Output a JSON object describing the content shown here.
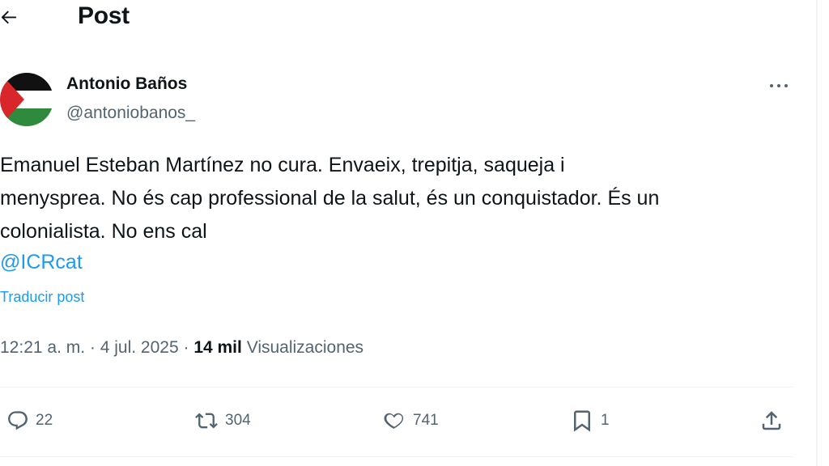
{
  "header": {
    "title": "Post"
  },
  "author": {
    "display_name": "Antonio Baños",
    "handle": "@antoniobanos_"
  },
  "post": {
    "text_lines": [
      "Emanuel Esteban Martínez no cura. Envaeix, trepitja, saqueja i",
      "menysprea. No és cap professional de la salut, és un conquistador. És un",
      "colonialista. No ens cal"
    ],
    "mention": "@ICRcat",
    "translate_label": "Traducir post",
    "timestamp": "12:21 a. m. · 4 jul. 2025",
    "separator": " · ",
    "views_count": "14 mil",
    "views_label": " Visualizaciones"
  },
  "actions": {
    "replies": "22",
    "reposts": "304",
    "likes": "741",
    "bookmarks": "1"
  },
  "colors": {
    "accent": "#1d9bf0",
    "text": "#0f1419",
    "secondary": "#536471"
  },
  "icons": {
    "back": "arrow-left-icon",
    "more": "more-horizontal-icon",
    "reply": "reply-icon",
    "repost": "repost-icon",
    "like": "heart-icon",
    "bookmark": "bookmark-icon",
    "share": "share-icon"
  }
}
